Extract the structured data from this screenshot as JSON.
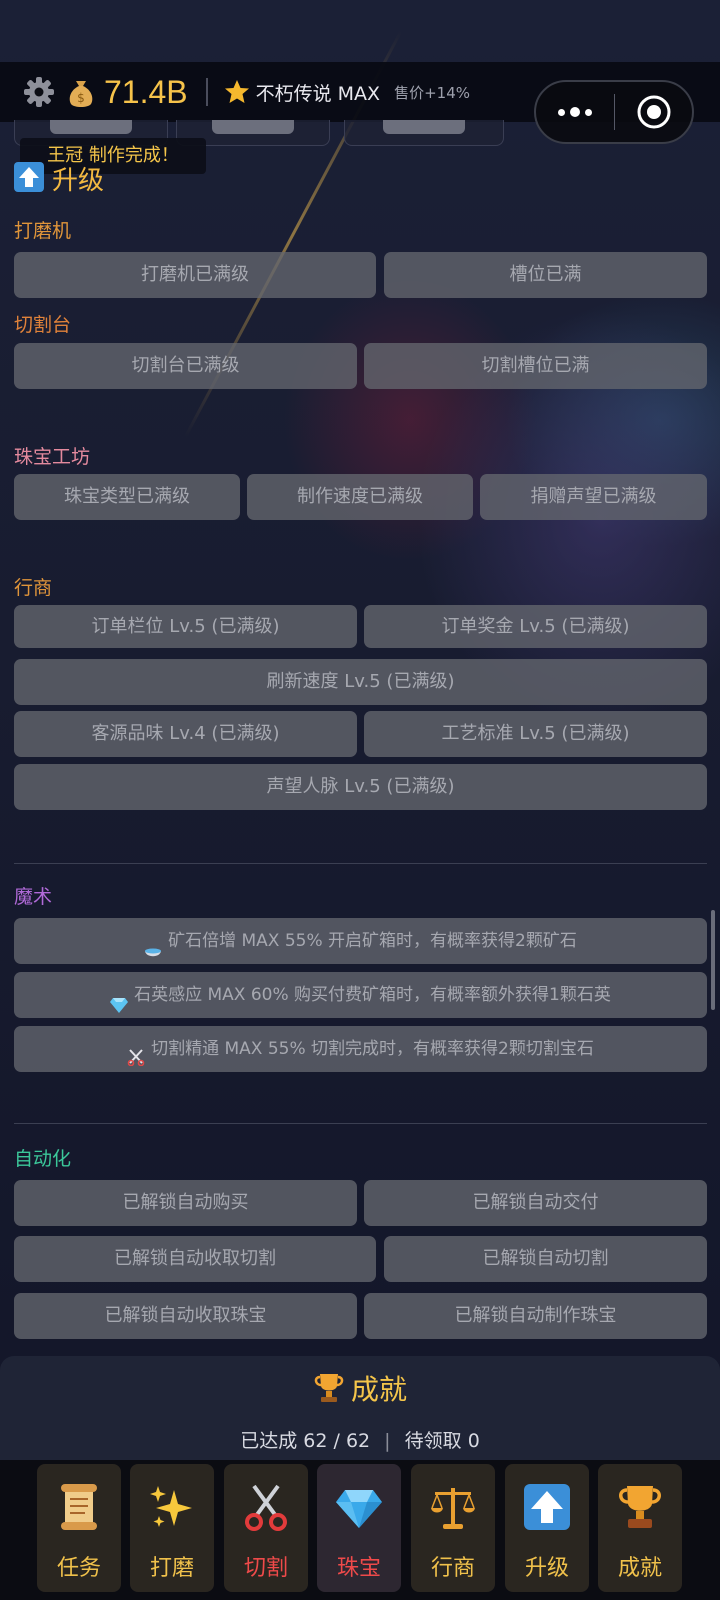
{
  "hud": {
    "money": "71.4B",
    "title": "不朽传说 MAX",
    "sale_bonus": "售价+14%"
  },
  "toast": "王冠 制作完成！",
  "upgrade_title": "升级",
  "sections": {
    "grinder": {
      "label": "打磨机",
      "color": "#e0953a",
      "buttons": [
        "打磨机已满级",
        "槽位已满"
      ]
    },
    "cutter": {
      "label": "切割台",
      "color": "#e0823a",
      "buttons": [
        "切割台已满级",
        "切割槽位已满"
      ]
    },
    "workshop": {
      "label": "珠宝工坊",
      "color": "#e48a9e",
      "buttons": [
        "珠宝类型已满级",
        "制作速度已满级",
        "捐赠声望已满级"
      ]
    },
    "merchant": {
      "label": "行商",
      "color": "#e0953a",
      "buttons": [
        "订单栏位 Lv.5 (已满级)",
        "订单奖金 Lv.5 (已满级)",
        "刷新速度 Lv.5 (已满级)",
        "客源品味 Lv.4 (已满级)",
        "工艺标准 Lv.5 (已满级)",
        "声望人脉 Lv.5 (已满级)"
      ]
    },
    "magic": {
      "label": "魔术",
      "color": "#b06ad8",
      "buttons": [
        "矿石倍增 MAX 55% 开启矿箱时，有概率获得2颗矿石",
        "石英感应 MAX 60% 购买付费矿箱时，有概率额外获得1颗石英",
        "切割精通 MAX 55% 切割完成时，有概率获得2颗切割宝石"
      ]
    },
    "automation": {
      "label": "自动化",
      "color": "#3bc79a",
      "buttons": [
        "已解锁自动购买",
        "已解锁自动交付",
        "已解锁自动收取切割",
        "已解锁自动切割",
        "已解锁自动收取珠宝",
        "已解锁自动制作珠宝"
      ]
    }
  },
  "achievement": {
    "title": "成就",
    "reached_label": "已达成",
    "reached": "62 / 62",
    "pending_label": "待领取",
    "pending": "0"
  },
  "nav": [
    "任务",
    "打磨",
    "切割",
    "珠宝",
    "行商",
    "升级",
    "成就"
  ]
}
